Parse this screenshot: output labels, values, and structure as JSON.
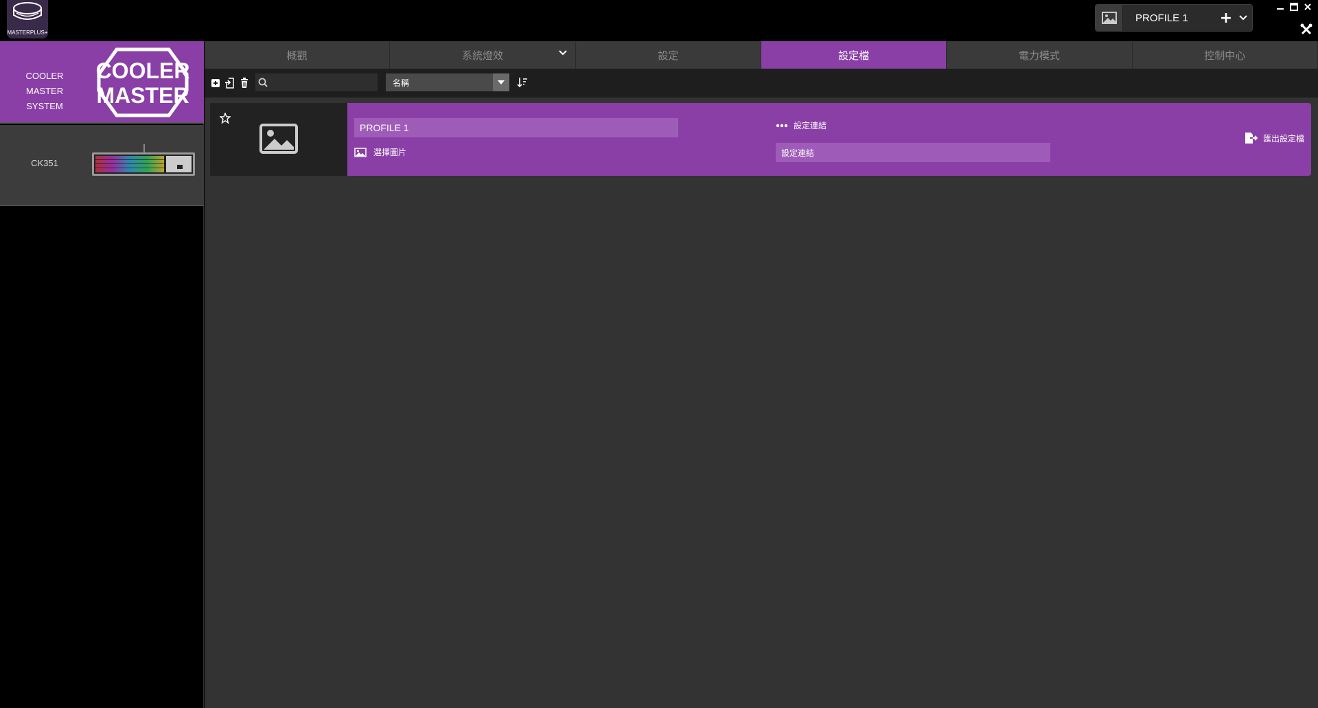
{
  "app": {
    "logo_text": "MASTERPLUS+"
  },
  "header": {
    "profile_name": "PROFILE 1"
  },
  "sidebar": {
    "devices": [
      {
        "label_line1": "COOLER MASTER",
        "label_line2": "SYSTEM",
        "logo_line1": "COOLER",
        "logo_line2": "MASTER"
      },
      {
        "label": "CK351"
      }
    ]
  },
  "tabs": [
    {
      "label": "概觀"
    },
    {
      "label": "系統燈效"
    },
    {
      "label": "設定"
    },
    {
      "label": "設定檔"
    },
    {
      "label": "電力模式"
    },
    {
      "label": "控制中心"
    }
  ],
  "toolbar": {
    "search_placeholder": "",
    "sort_value": "名稱"
  },
  "profile_row": {
    "name": "PROFILE 1",
    "choose_image_label": "選擇圖片",
    "link_label": "設定連結",
    "link_field": "設定連結",
    "export_label": "匯出設定檔"
  },
  "colors": {
    "accent": "#8a3fa6",
    "accent_light": "#9e5cb8",
    "background": "#333333"
  }
}
